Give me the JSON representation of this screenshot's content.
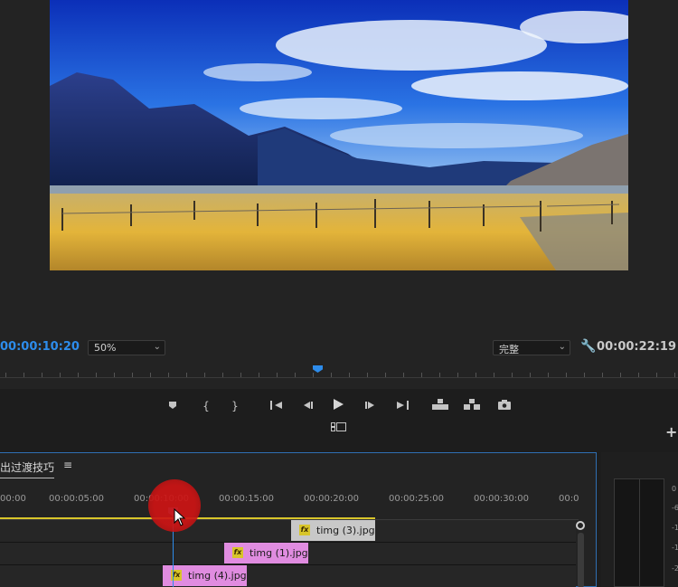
{
  "monitor": {
    "current_timecode": "00:00:10:20",
    "duration_timecode": "00:00:22:19",
    "zoom_select": "50%",
    "quality_select": "完整"
  },
  "icons": {
    "add_marker": "marker-icon",
    "mark_in": "mark-in-icon",
    "mark_out": "mark-out-icon",
    "go_to_in": "go-to-in-icon",
    "step_back": "step-back-icon",
    "play": "play-icon",
    "step_forward": "step-forward-icon",
    "go_to_out": "go-to-out-icon",
    "lift": "lift-icon",
    "extract": "extract-icon",
    "export_frame": "camera-icon",
    "settings": "wrench-icon",
    "multicam": "multicam-icon",
    "add": "plus-icon",
    "menu": "hamburger-icon"
  },
  "timeline": {
    "sequence_tab": "出过渡技巧",
    "menu_glyph": "≡",
    "ruler_labels": [
      "00:00",
      "00:00:05:00",
      "00:00:10:00",
      "00:00:15:00",
      "00:00:20:00",
      "00:00:25:00",
      "00:00:30:00",
      "00:0"
    ],
    "clips": [
      {
        "name": "timg (3).jpg",
        "fx": "fx"
      },
      {
        "name": "timg (1).jpg",
        "fx": "fx"
      },
      {
        "name": "timg (4).jpg",
        "fx": "fx"
      }
    ]
  },
  "meters": {
    "scale": [
      "0",
      "-6",
      "-1",
      "-1",
      "-2"
    ]
  },
  "colors": {
    "accent_blue": "#2d8ceb",
    "work_area_yellow": "#d8c52a",
    "clip_pink": "#e08ce0",
    "clip_gray": "#c8c8c8",
    "click_red": "#cd1414"
  }
}
